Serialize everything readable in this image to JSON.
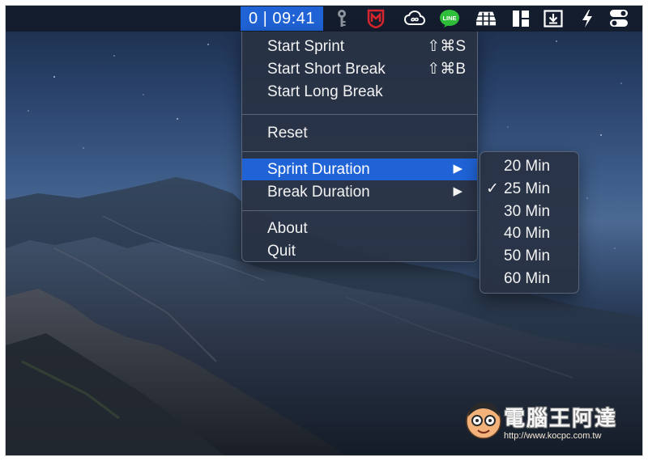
{
  "menubar": {
    "timer": "0 | 09:41",
    "icons": [
      "key-icon",
      "mcafee-icon",
      "creative-cloud-icon",
      "line-icon",
      "stack-icon",
      "layout-icon",
      "download-box-icon",
      "bolt-icon",
      "toggle-icon"
    ],
    "line_badge": "LINE"
  },
  "menu": {
    "items": [
      {
        "label": "Start Sprint",
        "shortcut": "⇧⌘S"
      },
      {
        "label": "Start Short Break",
        "shortcut": "⇧⌘B"
      },
      {
        "label": "Start Long Break"
      },
      {
        "label": "Reset"
      },
      {
        "label": "Sprint Duration",
        "arrow": "▶",
        "highlighted": true
      },
      {
        "label": "Break Duration",
        "arrow": "▶"
      },
      {
        "label": "About"
      },
      {
        "label": "Quit"
      }
    ]
  },
  "submenu": {
    "check_mark": "✓",
    "selected": "25 Min",
    "items": [
      "20 Min",
      "25 Min",
      "30 Min",
      "40 Min",
      "50 Min",
      "60 Min"
    ]
  },
  "colors": {
    "accent": "#1f63d6",
    "menubar": "#141d2e",
    "menu_bg": "#283244"
  },
  "watermark": {
    "title": "電腦王阿達",
    "url": "http://www.kocpc.com.tw"
  }
}
